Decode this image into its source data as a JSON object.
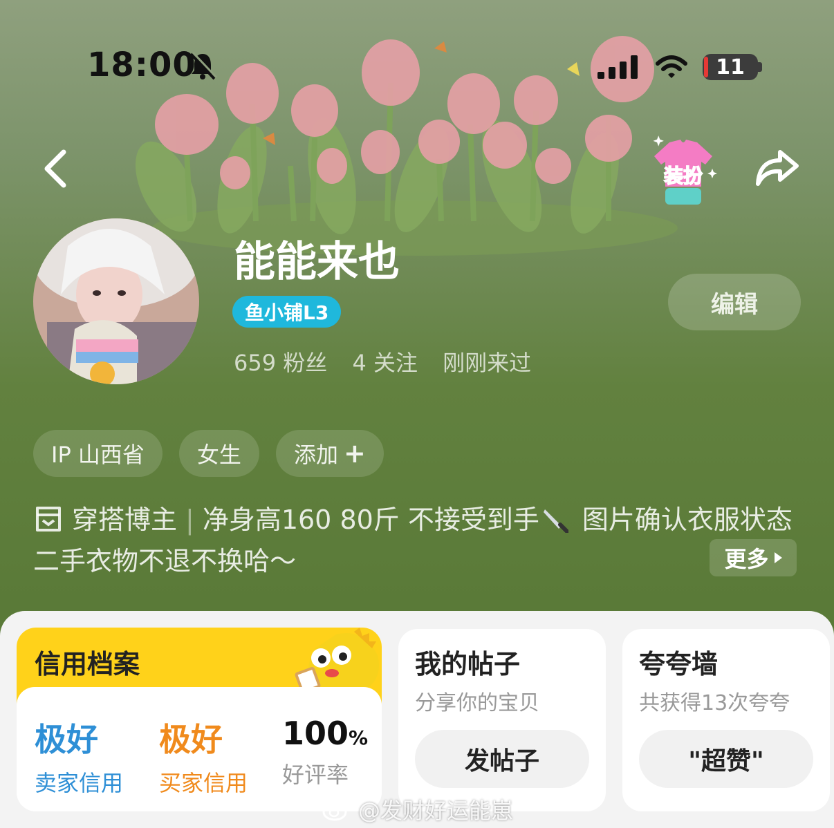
{
  "status_bar": {
    "time": "18:00",
    "battery": "11"
  },
  "header": {
    "dressup_label": "装扮"
  },
  "profile": {
    "nickname": "能能来也",
    "level_badge": "鱼小铺L3",
    "edit_label": "编辑",
    "followers": "659 粉丝",
    "following": "4 关注",
    "last_seen": "刚刚来过"
  },
  "tags": {
    "ip": "IP 山西省",
    "gender": "女生",
    "add": "添加"
  },
  "bio": {
    "role": "穿搭博主",
    "text_part1": "净身高160  80斤  不接受到手",
    "text_part2": "图片确认衣服状态  二手衣物不退不换哈～",
    "more_label": "更多"
  },
  "credit": {
    "title": "信用档案",
    "seller_value": "极好",
    "seller_label": "卖家信用",
    "buyer_value": "极好",
    "buyer_label": "买家信用",
    "rate_value": "100",
    "rate_unit": "%",
    "rate_label": "好评率"
  },
  "posts": {
    "title": "我的帖子",
    "subtitle": "分享你的宝贝",
    "button": "发帖子"
  },
  "praise": {
    "title": "夸夸墙",
    "subtitle": "共获得13次夸夸",
    "button": "\"超赞\""
  },
  "watermark": "@发财好运能崽",
  "colors": {
    "badge": "#1fb8dc",
    "seller": "#2e8fd6",
    "buyer": "#f08a1c",
    "credit_header": "#ffd21a"
  }
}
